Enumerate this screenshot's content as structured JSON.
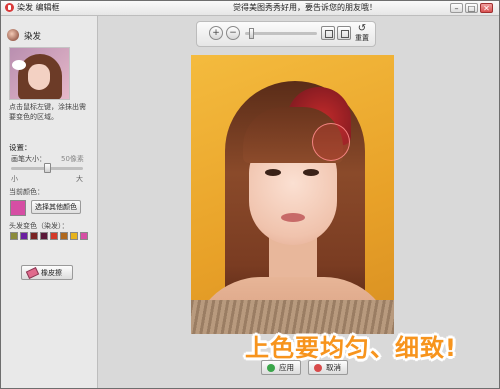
{
  "window": {
    "title": "染发 编辑框",
    "slogan": "觉得美图秀秀好用，要告诉您的朋友哦！",
    "min_label": "–",
    "max_label": "□",
    "close_label": "✕"
  },
  "tool": {
    "name": "染发",
    "instruction": "点击鼠标左键，涂抹出需要变色的区域。"
  },
  "settings": {
    "title": "设置：",
    "brush_size_label": "画笔大小：",
    "brush_size_value": "50像素",
    "brush_size_fraction": 0.5,
    "scale_min": "小",
    "scale_max": "大",
    "current_color_label": "当前颜色：",
    "current_color": "#d64ea4",
    "other_color_button": "选择其他颜色",
    "hair_color_label": "头发变色（染发）：",
    "hair_swatches": [
      "#8a8a3a",
      "#6b1fa0",
      "#7a2424",
      "#5a1838",
      "#d43a2a",
      "#b0681e",
      "#e7b31c",
      "#d64ea4"
    ],
    "eraser_button": "橡皮擦"
  },
  "toolbar": {
    "zoom_in_icon": "zoom-in-icon",
    "zoom_out_icon": "zoom-out-icon",
    "zoom_fraction": 0.05,
    "reset_label": "重置"
  },
  "canvas": {
    "overlay_text": "上色要均匀、细致!",
    "overlay_color": "#f7941d"
  },
  "footer": {
    "apply_label": "应用",
    "cancel_label": "取消"
  }
}
